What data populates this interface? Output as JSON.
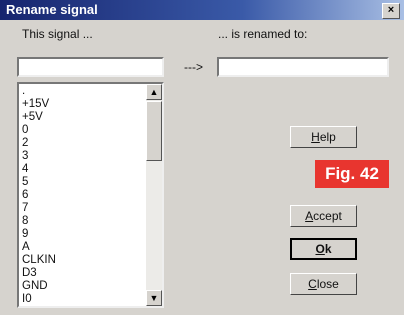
{
  "window": {
    "title": "Rename signal",
    "close_glyph": "×"
  },
  "labels": {
    "this_signal": "This signal ...",
    "renamed_to": "... is renamed to:",
    "arrow": "--->"
  },
  "fields": {
    "old_name_value": "",
    "new_name_value": ""
  },
  "signals": [
    ".",
    "+15V",
    "+5V",
    "0",
    "2",
    "3",
    "4",
    "5",
    "6",
    "7",
    "8",
    "9",
    "A",
    "CLKIN",
    "D3",
    "GND",
    "I0"
  ],
  "scrollbar": {
    "up_glyph": "▲",
    "down_glyph": "▼"
  },
  "buttons": {
    "help": "Help",
    "accept": "Accept",
    "ok": "Ok",
    "close": "Close"
  },
  "figure_label": "Fig. 42"
}
